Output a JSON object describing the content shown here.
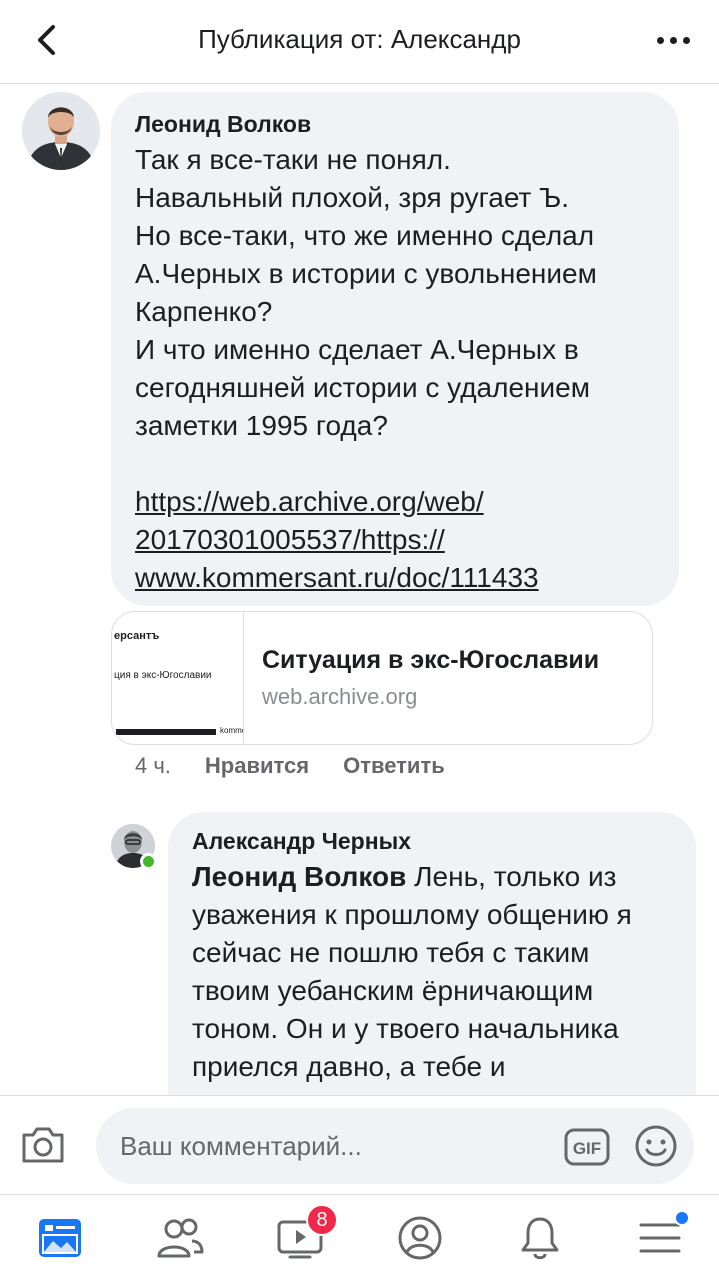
{
  "header": {
    "title": "Публикация от: Александр"
  },
  "comment1": {
    "author": "Леонид Волков",
    "text": "Так я все-таки не понял.\nНавальный плохой, зря ругает Ъ.\nНо все-таки, что же именно сделал А.Черных в истории с увольнением Карпенко?\nИ что именно сделает А.Черных в сегодняшней истории с удалением заметки 1995 года?",
    "link": "https://web.archive.org/web/\n20170301005537/https://\nwww.kommersant.ru/doc/111433"
  },
  "link_preview": {
    "thumb_brand": "ерсантъ",
    "thumb_headline": "ция в экс-Югославии",
    "thumb_small": "komme",
    "title": "Ситуация в экс-Югославии",
    "domain": "web.archive.org"
  },
  "actions": {
    "time": "4 ч.",
    "like": "Нравится",
    "reply": "Ответить"
  },
  "comment2": {
    "author": "Александр Черных",
    "mention": "Леонид Волков",
    "text": " Лень, только из уважения к прошлому общению я сейчас не пошлю тебя с таким твоим уебанским ёрничающим тоном. Он и у твоего начальника приелся давно, а тебе и"
  },
  "composer": {
    "placeholder": "Ваш комментарий...",
    "gif_label": "GIF"
  },
  "nav": {
    "video_badge": "8"
  },
  "colors": {
    "accent": "#1877f2",
    "badge": "#f02849",
    "online": "#42b72a",
    "bubble": "#f0f2f5"
  }
}
